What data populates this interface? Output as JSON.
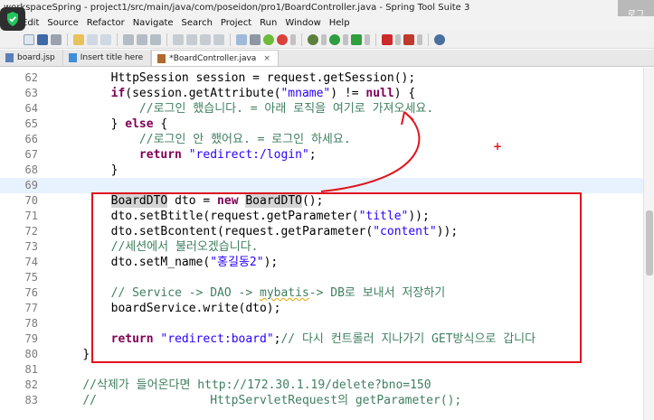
{
  "window": {
    "title": "workspaceSpring - project1/src/main/java/com/poseidon/pro1/BoardController.java - Spring Tool Suite 3",
    "corner_badge": "로그"
  },
  "menu": [
    "Edit",
    "Source",
    "Refactor",
    "Navigate",
    "Search",
    "Project",
    "Run",
    "Window",
    "Help"
  ],
  "tabs": [
    {
      "label": "board.jsp",
      "active": false
    },
    {
      "label": "Insert title here",
      "active": false
    },
    {
      "label": "*BoardController.java",
      "active": true
    }
  ],
  "lines": [
    {
      "n": "62",
      "indent": "        ",
      "tokens": [
        [
          "",
          "HttpSession session = request.getSession();"
        ]
      ]
    },
    {
      "n": "63",
      "indent": "        ",
      "tokens": [
        [
          "kw",
          "if"
        ],
        [
          "",
          "(session.getAttribute("
        ],
        [
          "str",
          "\"mname\""
        ],
        [
          "",
          ") != "
        ],
        [
          "kw",
          "null"
        ],
        [
          "",
          ") {"
        ]
      ]
    },
    {
      "n": "64",
      "indent": "            ",
      "tokens": [
        [
          "cmt",
          "//로그인 했습니다. = 아래 로직을 여기로 가져오세요."
        ]
      ]
    },
    {
      "n": "65",
      "indent": "        ",
      "tokens": [
        [
          "",
          "} "
        ],
        [
          "kw",
          "else"
        ],
        [
          "",
          " {"
        ]
      ]
    },
    {
      "n": "66",
      "indent": "            ",
      "tokens": [
        [
          "cmt",
          "//로그인 안 했어요. = 로그인 하세요."
        ]
      ]
    },
    {
      "n": "67",
      "indent": "            ",
      "tokens": [
        [
          "kw",
          "return"
        ],
        [
          "",
          " "
        ],
        [
          "str",
          "\"redirect:/login\""
        ],
        [
          "",
          ";"
        ]
      ]
    },
    {
      "n": "68",
      "indent": "        ",
      "tokens": [
        [
          "",
          "}"
        ]
      ]
    },
    {
      "n": "69",
      "indent": "",
      "tokens": [],
      "current": true
    },
    {
      "n": "70",
      "indent": "        ",
      "tokens": [
        [
          "hl",
          "BoardDTO"
        ],
        [
          "",
          " dto = "
        ],
        [
          "kw",
          "new"
        ],
        [
          "",
          " "
        ],
        [
          "hl",
          "BoardDTO"
        ],
        [
          "",
          "();"
        ]
      ]
    },
    {
      "n": "71",
      "indent": "        ",
      "tokens": [
        [
          "",
          "dto.setBtitle(request.getParameter("
        ],
        [
          "str",
          "\"title\""
        ],
        [
          "",
          "));"
        ]
      ]
    },
    {
      "n": "72",
      "indent": "        ",
      "tokens": [
        [
          "",
          "dto.setBcontent(request.getParameter("
        ],
        [
          "str",
          "\"content\""
        ],
        [
          "",
          "));"
        ]
      ]
    },
    {
      "n": "73",
      "indent": "        ",
      "tokens": [
        [
          "cmt",
          "//세션에서 불러오겠습니다."
        ]
      ]
    },
    {
      "n": "74",
      "indent": "        ",
      "tokens": [
        [
          "",
          "dto.setM_name("
        ],
        [
          "str",
          "\"홍길동2\""
        ],
        [
          "",
          ");"
        ]
      ]
    },
    {
      "n": "75",
      "indent": "",
      "tokens": []
    },
    {
      "n": "76",
      "indent": "        ",
      "tokens": [
        [
          "cmt",
          "// Service -> DAO -> "
        ],
        [
          "cmt squig",
          "mybatis"
        ],
        [
          "cmt",
          "-> DB로 보내서 저장하기"
        ]
      ]
    },
    {
      "n": "77",
      "indent": "        ",
      "tokens": [
        [
          "",
          "boardService.write(dto);"
        ]
      ]
    },
    {
      "n": "78",
      "indent": "",
      "tokens": []
    },
    {
      "n": "79",
      "indent": "        ",
      "tokens": [
        [
          "kw",
          "return"
        ],
        [
          "",
          " "
        ],
        [
          "str",
          "\"redirect:board\""
        ],
        [
          "",
          ";"
        ],
        [
          "cmt",
          "// 다시 컨트롤러 지나가기 GET방식으로 갑니다"
        ]
      ]
    },
    {
      "n": "80",
      "indent": "    ",
      "tokens": [
        [
          "",
          "}"
        ]
      ]
    },
    {
      "n": "81",
      "indent": "",
      "tokens": []
    },
    {
      "n": "82",
      "indent": "    ",
      "tokens": [
        [
          "cmt",
          "//삭제가 들어온다면 http://172.30.1.19/delete?bno=150"
        ]
      ]
    },
    {
      "n": "83",
      "indent": "    ",
      "tokens": [
        [
          "cmt",
          "//                HttpServletRequest의 getParameter();"
        ]
      ]
    }
  ],
  "annotation": {
    "box_color": "#e0141e",
    "arrow_color": "#e0141e",
    "marker": "+"
  },
  "colors": {
    "keyword": "#7f0055",
    "string": "#2a00ff",
    "comment": "#3f7f5f"
  }
}
